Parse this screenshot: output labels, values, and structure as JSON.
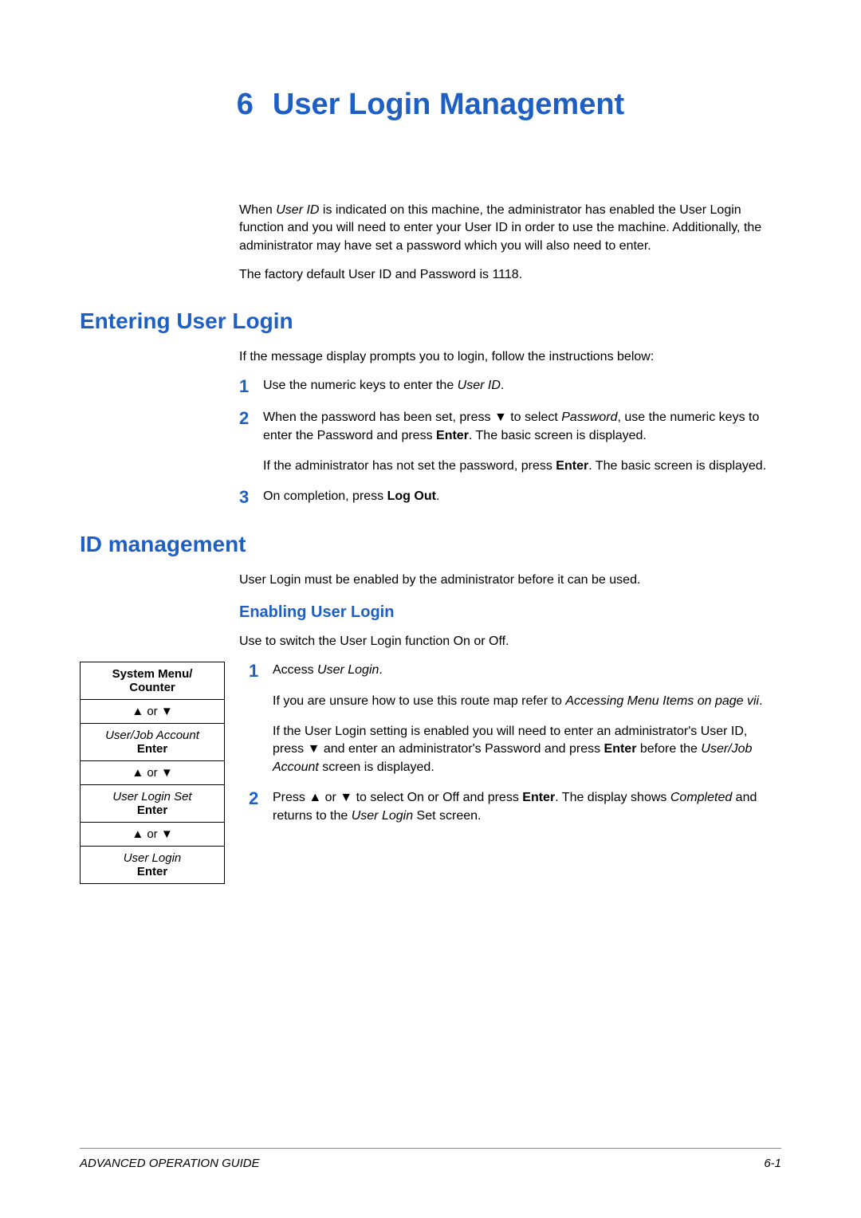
{
  "chapter": {
    "number": "6",
    "title": "User Login Management"
  },
  "intro": {
    "p1_before": "When ",
    "p1_em": "User ID",
    "p1_after": " is indicated on this machine, the administrator has enabled the User Login function and you will need to enter your User ID in order to use the machine. Additionally, the administrator may have set a password which you will also need to enter.",
    "p2": "The factory default User ID and Password is 1118."
  },
  "section1": {
    "heading": "Entering User Login",
    "intro": "If the message display prompts you to login, follow the instructions below:",
    "steps": [
      {
        "num": "1",
        "parts": [
          {
            "t": "Use the numeric keys to enter the "
          },
          {
            "t": "User ID",
            "em": true
          },
          {
            "t": "."
          }
        ]
      },
      {
        "num": "2",
        "parts": [
          {
            "t": "When the password has been set, press ▼ to select "
          },
          {
            "t": "Password",
            "em": true
          },
          {
            "t": ", use the numeric keys to enter the Password and press "
          },
          {
            "t": "Enter",
            "b": true
          },
          {
            "t": ". The basic screen is displayed."
          }
        ],
        "para2": [
          {
            "t": "If the administrator has not set the password, press "
          },
          {
            "t": "Enter",
            "b": true
          },
          {
            "t": ". The basic screen is displayed."
          }
        ]
      },
      {
        "num": "3",
        "parts": [
          {
            "t": "On completion, press "
          },
          {
            "t": "Log Out",
            "b": true
          },
          {
            "t": "."
          }
        ]
      }
    ]
  },
  "section2": {
    "heading": "ID management",
    "intro": "User Login must be enabled by the administrator before it can be used.",
    "sub": {
      "heading": "Enabling User Login",
      "intro": "Use to switch the User Login function On or Off.",
      "menu": {
        "row1_a": "System Menu/",
        "row1_b": "Counter",
        "nav": "▲ or ▼",
        "row2_a": "User/Job Account",
        "row2_b": "Enter",
        "row3_a": "User Login Set",
        "row3_b": "Enter",
        "row4_a": "User Login",
        "row4_b": "Enter"
      },
      "steps": [
        {
          "num": "1",
          "parts": [
            {
              "t": "Access "
            },
            {
              "t": "User Login",
              "em": true
            },
            {
              "t": "."
            }
          ],
          "para2": [
            {
              "t": "If you are unsure how to use this route map refer to "
            },
            {
              "t": "Accessing Menu Items on page vii",
              "em": true
            },
            {
              "t": "."
            }
          ],
          "para3": [
            {
              "t": "If the User Login setting is enabled you will need to enter an administrator's User ID, press ▼ and enter an administrator's Password and press "
            },
            {
              "t": "Enter",
              "b": true
            },
            {
              "t": " before the "
            },
            {
              "t": "User/Job Account",
              "em": true
            },
            {
              "t": " screen is displayed."
            }
          ]
        },
        {
          "num": "2",
          "parts": [
            {
              "t": "Press ▲ or ▼ to select On or Off and press "
            },
            {
              "t": "Enter",
              "b": true
            },
            {
              "t": ". The display shows "
            },
            {
              "t": "Completed",
              "em": true
            },
            {
              "t": " and returns to the "
            },
            {
              "t": "User Login",
              "em": true
            },
            {
              "t": " Set screen."
            }
          ]
        }
      ]
    }
  },
  "footer": {
    "left": "ADVANCED OPERATION GUIDE",
    "right": "6-1"
  }
}
